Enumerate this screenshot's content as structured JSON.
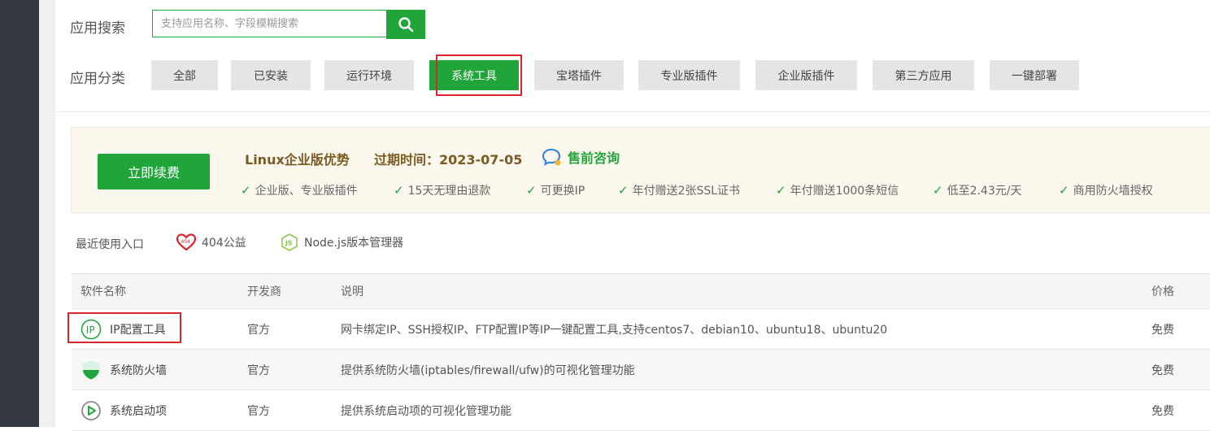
{
  "search": {
    "label": "应用搜索",
    "placeholder": "支持应用名称、字段模糊搜索",
    "value": ""
  },
  "categories": {
    "label": "应用分类",
    "items": [
      "全部",
      "已安装",
      "运行环境",
      "系统工具",
      "宝塔插件",
      "专业版插件",
      "企业版插件",
      "第三方应用",
      "一键部署"
    ],
    "selected": "系统工具"
  },
  "promo": {
    "renew_label": "立即续费",
    "title": "Linux企业版优势",
    "expire": "过期时间：2023-07-05",
    "consult": "售前咨询",
    "features": [
      "企业版、专业版插件",
      "15天无理由退款",
      "可更换IP",
      "年付赠送2张SSL证书",
      "年付赠送1000条短信",
      "低至2.43元/天",
      "商用防火墙授权"
    ]
  },
  "recent": {
    "label": "最近使用入口",
    "items": [
      {
        "label": "404公益",
        "icon": "heart-404-icon"
      },
      {
        "label": "Node.js版本管理器",
        "icon": "nodejs-icon"
      }
    ]
  },
  "table": {
    "headers": {
      "name": "软件名称",
      "developer": "开发商",
      "description": "说明",
      "price": "价格"
    },
    "rows": [
      {
        "name": "IP配置工具",
        "icon": "ip-icon",
        "developer": "官方",
        "description": "网卡绑定IP、SSH授权IP、FTP配置IP等IP一键配置工具,支持centos7、debian10、ubuntu18、ubuntu20",
        "price": "免费"
      },
      {
        "name": "系统防火墙",
        "icon": "shield-icon",
        "developer": "官方",
        "description": "提供系统防火墙(iptables/firewall/ufw)的可视化管理功能",
        "price": "免费"
      },
      {
        "name": "系统启动项",
        "icon": "play-icon",
        "developer": "官方",
        "description": "提供系统启动项的可视化管理功能",
        "price": "免费"
      }
    ]
  },
  "colors": {
    "accent": "#20a53a",
    "highlight_outline": "#d9262c",
    "promo_bg": "#fdf8ee",
    "sidebar": "#353a40"
  }
}
